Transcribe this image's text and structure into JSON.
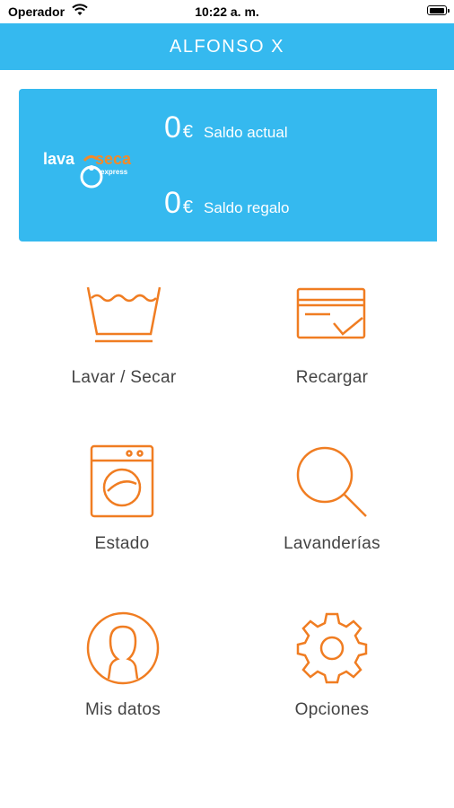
{
  "status_bar": {
    "carrier": "Operador",
    "time": "10:22 a. m.",
    "battery_level": 0.95
  },
  "header": {
    "title": "ALFONSO X"
  },
  "balance": {
    "logo": {
      "lava": "lava",
      "seca": "seca",
      "express": "express"
    },
    "current": {
      "amount": "0",
      "currency": "€",
      "label": "Saldo actual"
    },
    "gift": {
      "amount": "0",
      "currency": "€",
      "label": "Saldo regalo"
    }
  },
  "menu": [
    {
      "label": "Lavar / Secar",
      "icon": "wash-basin-icon"
    },
    {
      "label": "Recargar",
      "icon": "credit-card-icon"
    },
    {
      "label": "Estado",
      "icon": "washing-machine-icon"
    },
    {
      "label": "Lavanderías",
      "icon": "search-icon"
    },
    {
      "label": "Mis datos",
      "icon": "user-profile-icon"
    },
    {
      "label": "Opciones",
      "icon": "gear-icon"
    }
  ],
  "colors": {
    "primary": "#35b9ef",
    "accent": "#f07d22",
    "text": "#444444"
  }
}
